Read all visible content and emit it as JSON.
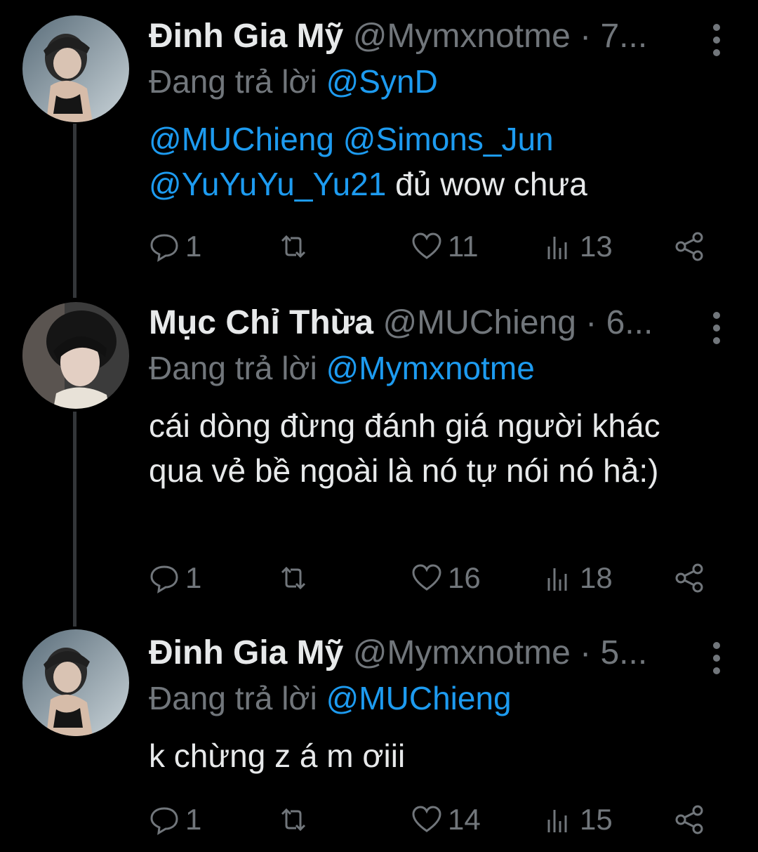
{
  "tweets": [
    {
      "name": "Đinh Gia Mỹ",
      "handle": "@Mymxnotme",
      "time": "· 7...",
      "reply_prefix": "Đang trả lời",
      "reply_to": "@SynD",
      "body_mentions": "@MUChieng @Simons_Jun",
      "body_mention2": "@YuYuYu_Yu21",
      "body_text": " đủ wow chưa",
      "replies": "1",
      "likes": "11",
      "views": "13"
    },
    {
      "name": "Mục Chỉ Thừa",
      "handle": "@MUChieng",
      "time": "· 6...",
      "reply_prefix": "Đang trả lời",
      "reply_to": "@Mymxnotme",
      "body_text": "cái dòng đừng đánh giá người khác qua vẻ bề ngoài là nó tự nói nó hả:)",
      "replies": "1",
      "likes": "16",
      "views": "18"
    },
    {
      "name": "Đinh Gia Mỹ",
      "handle": "@Mymxnotme",
      "time": "· 5...",
      "reply_prefix": "Đang trả lời",
      "reply_to": "@MUChieng",
      "body_text": "k chừng z á m ơiii",
      "replies": "1",
      "likes": "14",
      "views": "15"
    }
  ],
  "icons": [
    "reply-icon",
    "retweet-icon",
    "like-icon",
    "views-icon",
    "share-icon",
    "more-icon"
  ],
  "colors": {
    "background": "#000000",
    "text": "#e7e9ea",
    "muted": "#71767b",
    "accent": "#1d9bf0"
  }
}
